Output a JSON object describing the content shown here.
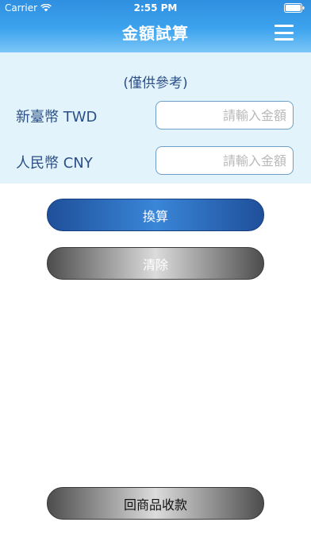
{
  "status_bar": {
    "carrier": "Carrier",
    "time": "2:55 PM",
    "icons": [
      "wifi-icon",
      "battery-icon"
    ]
  },
  "nav": {
    "title": "金額試算",
    "menu_icon": "hamburger-menu-icon"
  },
  "form": {
    "note": "(僅供參考)",
    "twd": {
      "label": "新臺幣 TWD",
      "value": "",
      "placeholder": "請輸入金額"
    },
    "cny": {
      "label": "人民幣 CNY",
      "value": "",
      "placeholder": "請輸入金額"
    }
  },
  "buttons": {
    "convert": "換算",
    "clear": "清除",
    "back": "回商品收款"
  },
  "colors": {
    "nav_blue": "#3da3ee",
    "panel_bg": "#e2f3fb",
    "label_text": "#2b4f86",
    "convert_button": "#3a86d8",
    "neutral_button": "#808080"
  }
}
